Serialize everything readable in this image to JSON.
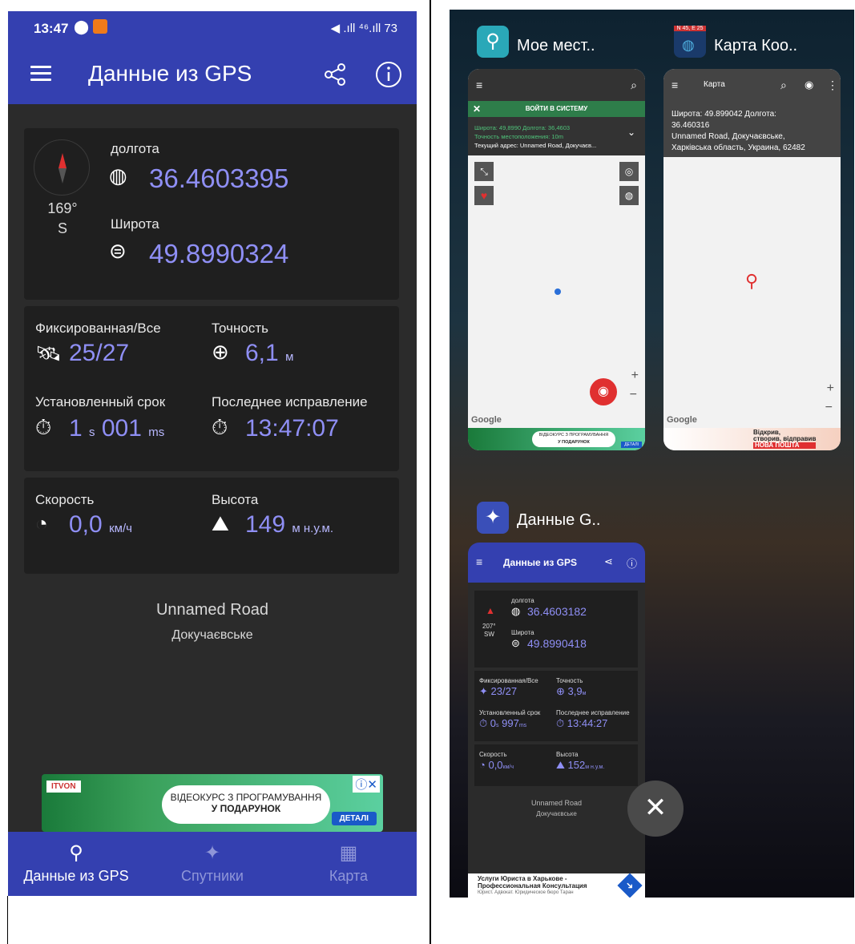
{
  "left": {
    "status": {
      "time": "13:47",
      "indicators": "◀ .ıll ⁴⁶.ıll 73"
    },
    "appbar": {
      "title": "Данные из GPS"
    },
    "compass": {
      "degrees": "169°",
      "dir": "S"
    },
    "longitude": {
      "label": "долгота",
      "value": "36.4603395"
    },
    "latitude": {
      "label": "Широта",
      "value": "49.8990324"
    },
    "sats": {
      "label": "Фиксированная/Все",
      "value": "25/27"
    },
    "accuracy": {
      "label": "Точность",
      "value": "6,1",
      "unit": "м"
    },
    "ttf": {
      "label": "Установленный срок",
      "v1": "1",
      "u1": "s",
      "v2": "001",
      "u2": "ms"
    },
    "lastfix": {
      "label": "Последнее исправление",
      "value": "13:47:07"
    },
    "speed": {
      "label": "Скорость",
      "value": "0,0",
      "unit": "км/ч"
    },
    "altitude": {
      "label": "Высота",
      "value": "149",
      "unit": "м н.у.м."
    },
    "address": {
      "line1": "Unnamed Road",
      "line2": "Докучаєвське"
    },
    "ad": {
      "brand": "ITVON",
      "line1": "ВІДЕОКУРС З ПРОГРАМУВАННЯ",
      "line2": "У ПОДАРУНОК",
      "cta": "ДЕТАЛІ"
    },
    "nav": [
      {
        "label": "Данные из GPS"
      },
      {
        "label": "Спутники"
      },
      {
        "label": "Карта"
      }
    ]
  },
  "right": {
    "app1": {
      "title": "Мое мест..",
      "login": "ВОЙТИ В СИСТЕМУ",
      "info1": "Широта: 49,8990 Долгота: 36,4603",
      "info2": "Точность местоположения: 10m",
      "info3": "Текущий адрес: Unnamed Road, Докучаєв...",
      "google": "Google",
      "ad1": "ВІДЕОКУРС З ПРОГРАМУВАННЯ",
      "ad2": "У ПОДАРУНОК",
      "ad_cta": "ДЕТАЛІ"
    },
    "app2": {
      "title": "Карта Коо..",
      "icon_text": "N 45, E 25",
      "bar_label": "Карта",
      "info1": "Широта: 49.899042 Долгота:",
      "info2": "36.460316",
      "info3": "Unnamed Road, Докучаєвське,",
      "info4": "Харківська область, Украина, 62482",
      "google": "Google",
      "ad1": "Відкрив,",
      "ad2": "створив, відправив",
      "ad3": "НОВА ПОШТА"
    },
    "app3": {
      "title": "Данные G..",
      "bar_title": "Данные из GPS",
      "lon_label": "долгота",
      "lon": "36.4603182",
      "lat_label": "Широта",
      "lat": "49.8990418",
      "deg": "207°",
      "dir": "SW",
      "sats_label": "Фиксированная/Все",
      "sats": "23/27",
      "acc_label": "Точность",
      "acc": "3,9",
      "acc_unit": "м",
      "ttf_label": "Установленный срок",
      "ttf1": "0",
      "ttf_u1": "s",
      "ttf2": "997",
      "ttf_u2": "ms",
      "fix_label": "Последнее исправление",
      "fix": "13:44:27",
      "speed_label": "Скорость",
      "speed": "0,0",
      "speed_unit": "км/ч",
      "alt_label": "Высота",
      "alt": "152",
      "alt_unit": "м н.у.м.",
      "addr1": "Unnamed Road",
      "addr2": "Докучаєвське",
      "ad1": "Услуги Юриста в Харькове -",
      "ad2": "Профессиональная Консультация",
      "ad3": "Юрист. Адвокат. Юридическое бюро Таран"
    }
  }
}
